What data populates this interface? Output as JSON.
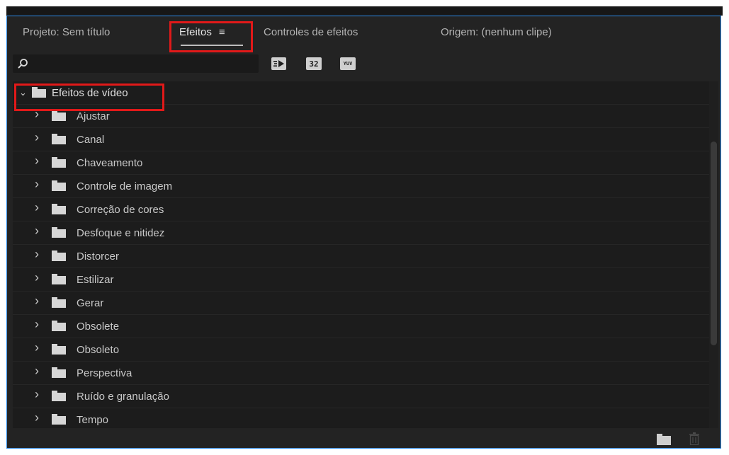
{
  "tabs": {
    "project": "Projeto: Sem título",
    "effects": "Efeitos",
    "effects_menu": "≡",
    "effect_controls": "Controles de efeitos",
    "source": "Origem: (nenhum clipe)"
  },
  "search": {
    "value": "",
    "placeholder": ""
  },
  "filters": {
    "accelerated_icon": "accelerated-effects-icon",
    "bit32_label": "32",
    "yuv_label": "YUV"
  },
  "tree": {
    "root": "Efeitos de vídeo",
    "items": [
      "Ajustar",
      "Canal",
      "Chaveamento",
      "Controle de imagem",
      "Correção de cores",
      "Desfoque e nitidez",
      "Distorcer",
      "Estilizar",
      "Gerar",
      "Obsolete",
      "Obsoleto",
      "Perspectiva",
      "Ruído e granulação",
      "Tempo"
    ]
  },
  "footer": {
    "new_bin_icon": "new-bin-icon",
    "delete_icon": "trash-icon"
  },
  "colors": {
    "panel_bg": "#232323",
    "list_bg": "#1c1c1c",
    "panel_border": "#2d8ceb",
    "highlight": "#e11919",
    "text": "#c8c8c8"
  }
}
